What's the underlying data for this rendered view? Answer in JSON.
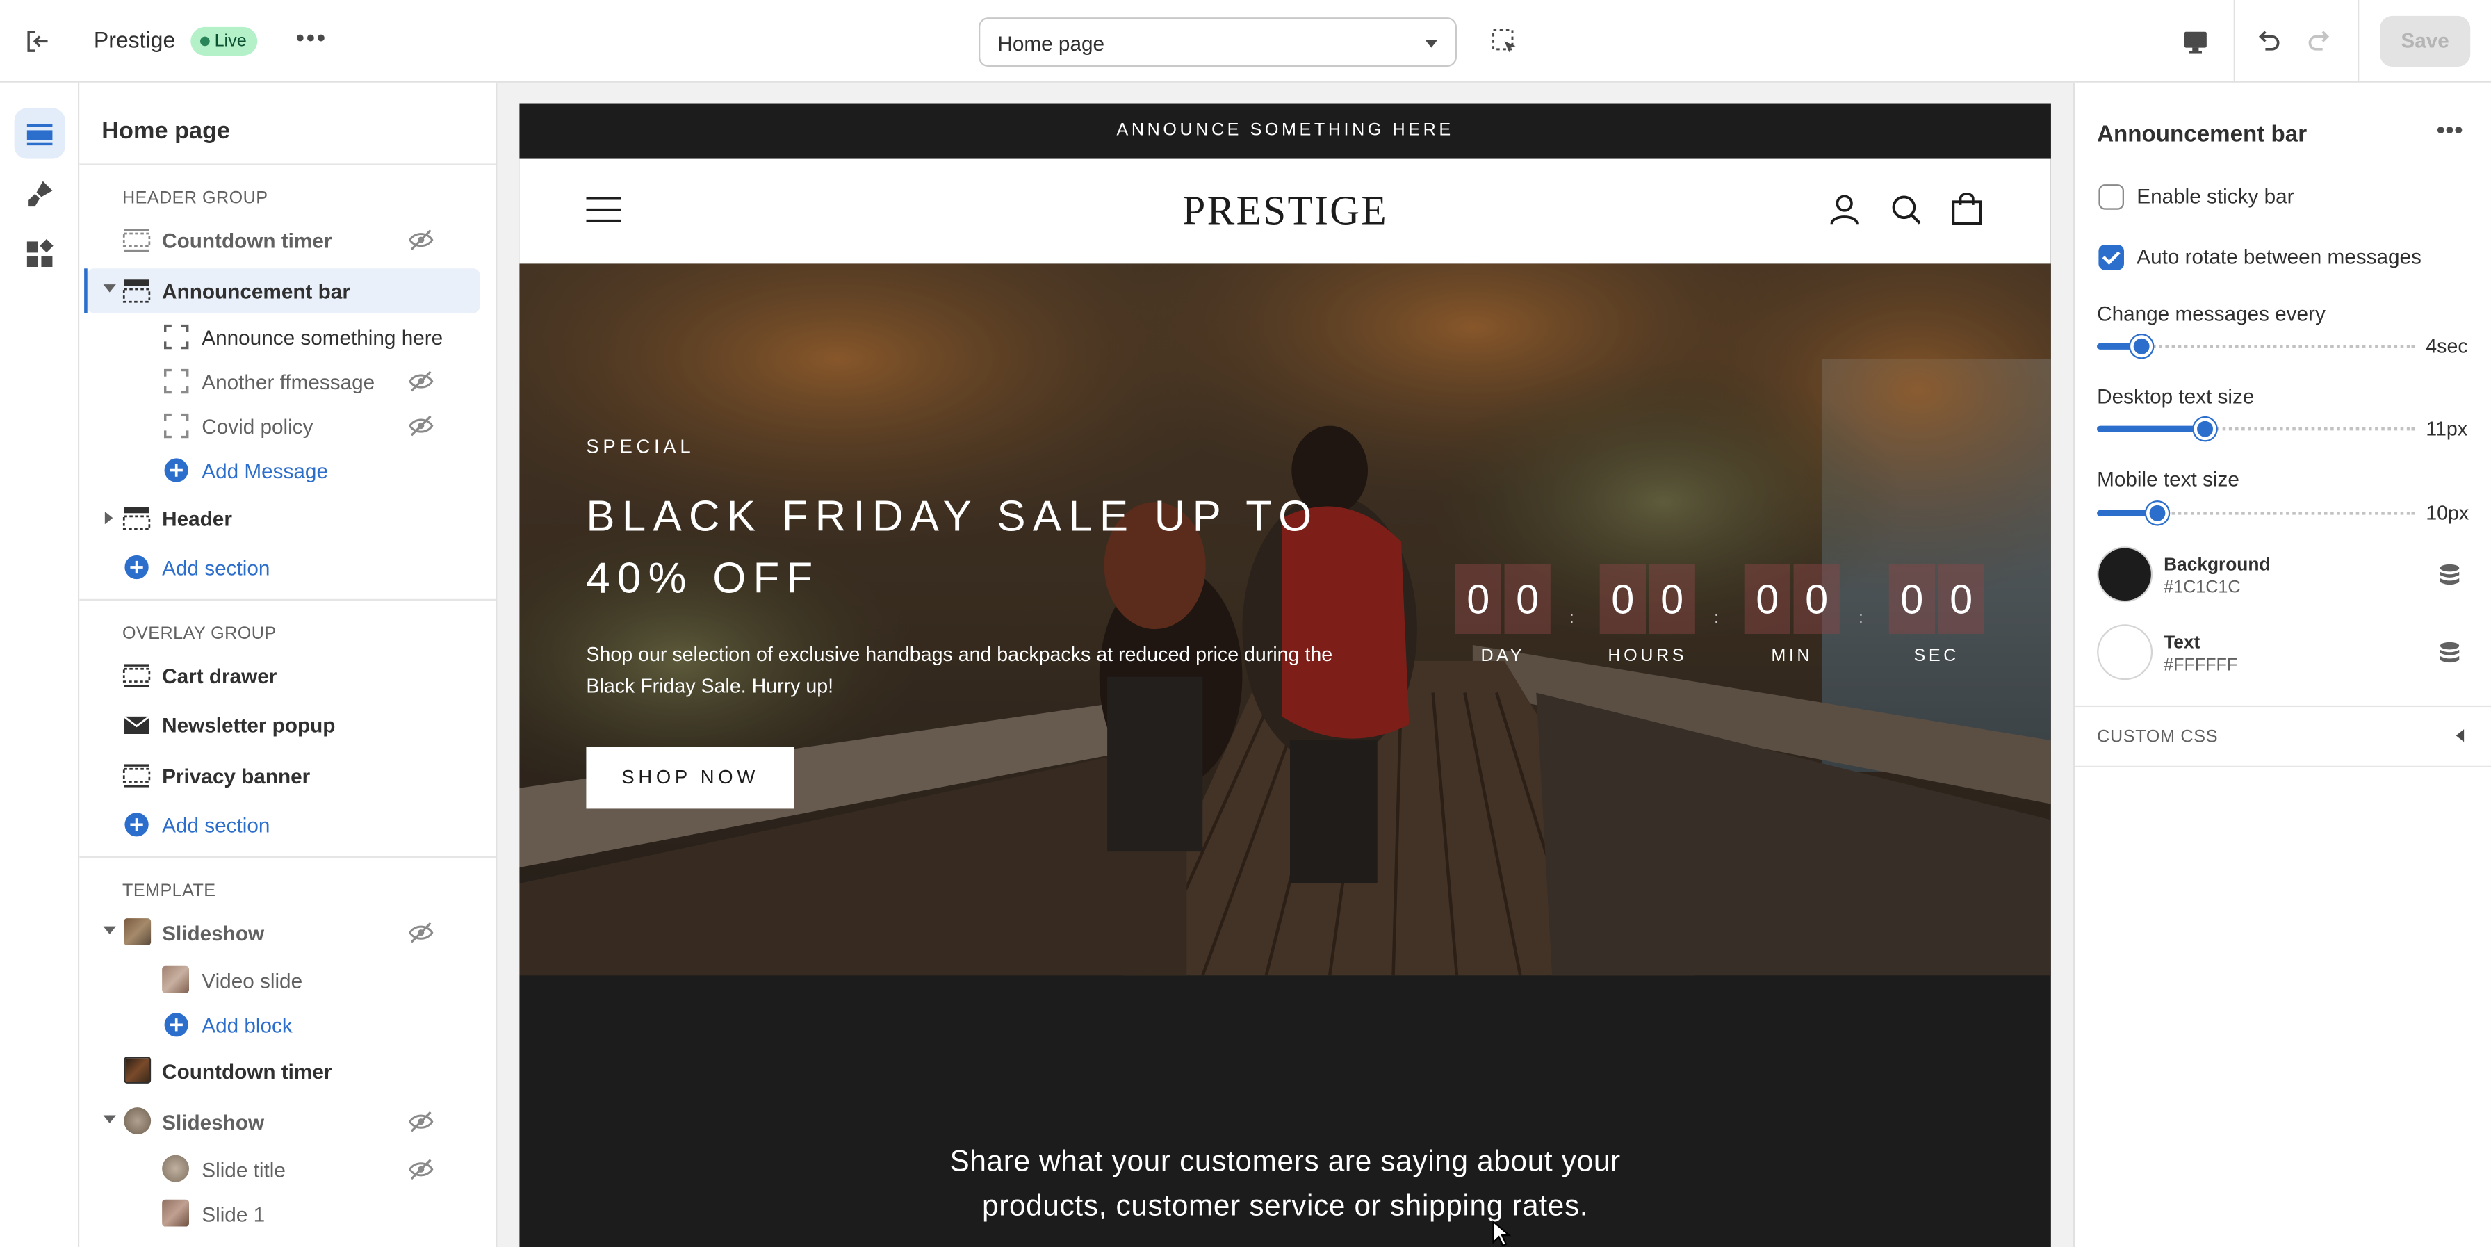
{
  "topbar": {
    "store_name": "Prestige",
    "status_badge": "Live",
    "page_select_value": "Home page",
    "save_label": "Save"
  },
  "sidebar": {
    "title": "Home page",
    "header_group": {
      "label": "HEADER GROUP",
      "items": [
        {
          "label": "Countdown timer",
          "hidden": true
        },
        {
          "label": "Announcement bar",
          "selected": true
        },
        {
          "label": "Announce something here"
        },
        {
          "label": "Another ffmessage",
          "hidden": true
        },
        {
          "label": "Covid policy",
          "hidden": true
        },
        {
          "label": "Add Message"
        },
        {
          "label": "Header"
        },
        {
          "label": "Add section"
        }
      ]
    },
    "overlay_group": {
      "label": "OVERLAY GROUP",
      "items": [
        {
          "label": "Cart drawer"
        },
        {
          "label": "Newsletter popup"
        },
        {
          "label": "Privacy banner"
        },
        {
          "label": "Add section"
        }
      ]
    },
    "template": {
      "label": "TEMPLATE",
      "items": [
        {
          "label": "Slideshow",
          "hidden": true
        },
        {
          "label": "Video slide"
        },
        {
          "label": "Add block"
        },
        {
          "label": "Countdown timer"
        },
        {
          "label": "Slideshow",
          "hidden": true
        },
        {
          "label": "Slide title",
          "hidden": true
        },
        {
          "label": "Slide 1"
        }
      ]
    }
  },
  "preview": {
    "announcement": "ANNOUNCE SOMETHING HERE",
    "logo": "PRESTIGE",
    "hero": {
      "eyebrow": "SPECIAL",
      "title": "BLACK FRIDAY SALE UP TO 40% OFF",
      "text": "Shop our selection of exclusive handbags and backpacks at reduced price during the Black Friday Sale. Hurry up!",
      "button": "SHOP NOW"
    },
    "countdown": [
      {
        "d1": "0",
        "d2": "0",
        "label": "DAY"
      },
      {
        "d1": "0",
        "d2": "0",
        "label": "HOURS"
      },
      {
        "d1": "0",
        "d2": "0",
        "label": "MIN"
      },
      {
        "d1": "0",
        "d2": "0",
        "label": "SEC"
      }
    ],
    "countdown_separator": ":",
    "testimonial_line1": "Share what your customers are saying about your",
    "testimonial_line2": "products, customer service or shipping rates."
  },
  "settings": {
    "title": "Announcement bar",
    "sticky": {
      "label": "Enable sticky bar",
      "checked": false
    },
    "rotate": {
      "label": "Auto rotate between messages",
      "checked": true
    },
    "sliders": [
      {
        "label": "Change messages every",
        "value": "4sec",
        "fraction": 0.14
      },
      {
        "label": "Desktop text size",
        "value": "11px",
        "fraction": 0.34
      },
      {
        "label": "Mobile text size",
        "value": "10px",
        "fraction": 0.19
      }
    ],
    "colors": [
      {
        "name": "Background",
        "value": "#1C1C1C"
      },
      {
        "name": "Text",
        "value": "#FFFFFF"
      }
    ],
    "custom_css_label": "CUSTOM CSS"
  },
  "colors": {
    "accent": "#2c6ecb",
    "live_badge": "#b4f1c9",
    "announcement_bg": "#1c1c1c"
  }
}
